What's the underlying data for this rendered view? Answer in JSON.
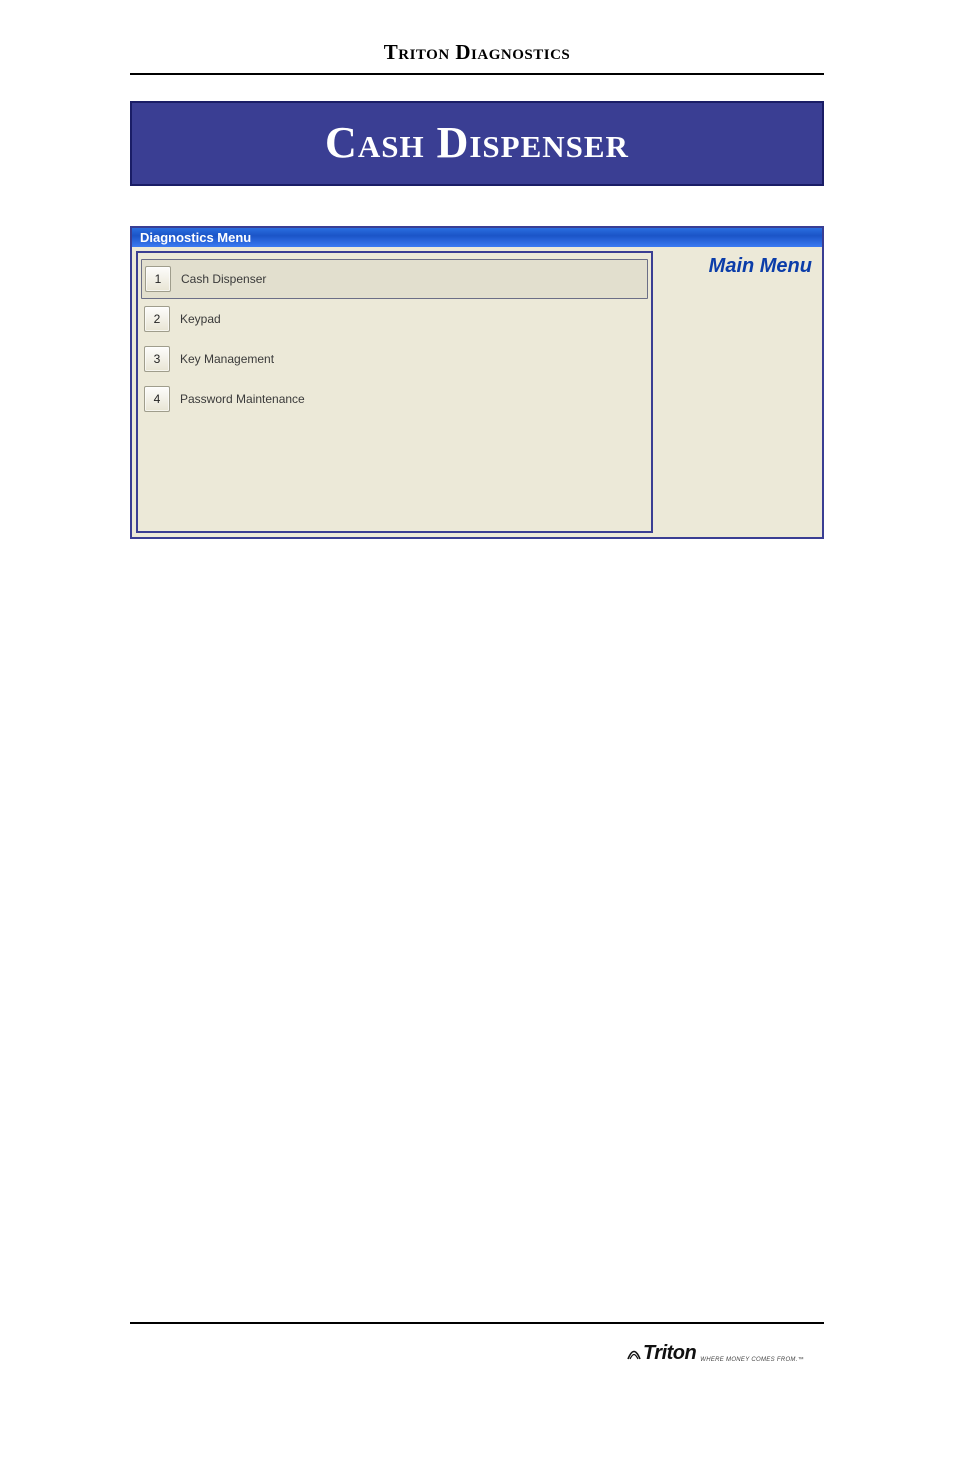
{
  "doc_header": "Triton Diagnostics",
  "title": "Cash Dispenser",
  "window": {
    "title": "Diagnostics Menu",
    "main_menu_label": "Main Menu",
    "items": [
      {
        "num": "1",
        "label": "Cash Dispenser",
        "selected": true
      },
      {
        "num": "2",
        "label": "Keypad",
        "selected": false
      },
      {
        "num": "3",
        "label": "Key Management",
        "selected": false
      },
      {
        "num": "4",
        "label": "Password Maintenance",
        "selected": false
      }
    ]
  },
  "footer": {
    "brand": "Triton",
    "tagline": "WHERE MONEY COMES FROM.™"
  }
}
